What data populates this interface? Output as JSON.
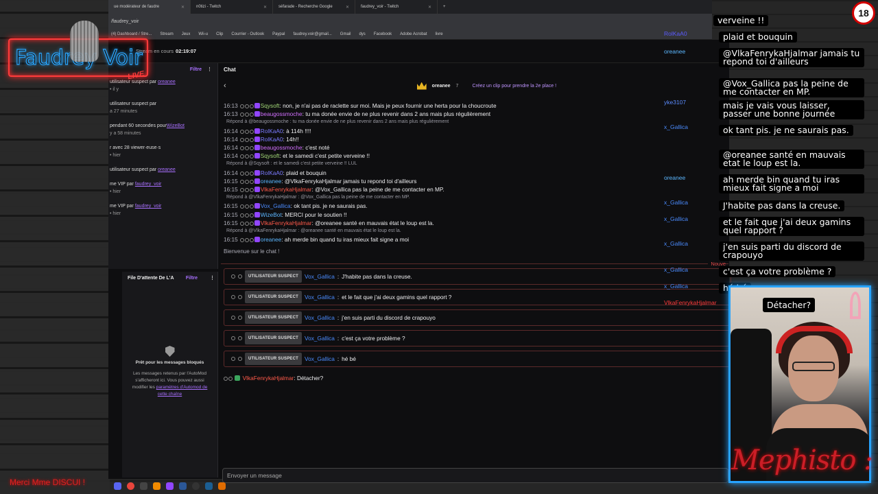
{
  "browser": {
    "tabs": [
      {
        "label": "ue modérateur de faudre"
      },
      {
        "label": "n0tizi - Twitch"
      },
      {
        "label": "séfarade - Recherche Google"
      },
      {
        "label": "faudrey_voir - Twitch"
      }
    ],
    "address": "/faudrey_voir",
    "bookmarks": [
      "(4) Dashboard / Stre...",
      "Stream",
      "Jeux",
      "Wii-u",
      "Clip",
      "Courrier - Outlook",
      "Paypal",
      "faudrey.voir@gmail...",
      "Gmail",
      "dys",
      "Facebook",
      "Adobe Acrobat",
      "livre"
    ]
  },
  "dashboard": {
    "stream_label": "Stream en cours",
    "stream_time": "02:19:07",
    "activity": {
      "filter": "Filtre",
      "items": [
        {
          "text": "utilisateur suspect par ",
          "link": "oreanee",
          "sub": "• il y"
        },
        {
          "text": "utilisateur suspect par",
          "link": "",
          "sub": "a 27 minutes"
        },
        {
          "text": "pendant 60 secondes pour",
          "link": "WizeBot",
          "sub": "y a 58 minutes"
        },
        {
          "text": "r avec 28 viewer·euse·s",
          "link": "",
          "sub": "• hier"
        },
        {
          "text": "utilisateur suspect par ",
          "link": "oreanee",
          "sub": ""
        },
        {
          "text": "me VIP par ",
          "link": "faudrey_voir",
          "sub": "• hier"
        },
        {
          "text": "me VIP par ",
          "link": "faudrey_voir",
          "sub": "• hier"
        }
      ]
    },
    "queue": {
      "title": "File D'attente De L'A",
      "filter": "Filtre",
      "empty_title": "Prêt pour les messages bloqués",
      "empty_text": "Les messages retenus par l'AutoMod s'afficheront ici. Vous pouvez aussi modifier les",
      "empty_link": "paramètres d'Automod de cette chaîne"
    }
  },
  "chat": {
    "title": "Chat",
    "pinned_user": "oreanee",
    "pinned_count": "7",
    "pinned_clip": "Créez un clip pour prendre la 2e place !",
    "messages": [
      {
        "time": "16:13",
        "user": "Sqysoft",
        "color": "#a3d977",
        "text": "non, je n'ai pas de raclette sur moi. Mais je peux fournir une herta pour la choucroute",
        "reply": ""
      },
      {
        "time": "16:13",
        "user": "beaugossmoche",
        "color": "#d270ff",
        "text": "tu ma donée envie de ne plus revenir dans 2 ans mais plus régulièrement",
        "reply": ""
      },
      {
        "time": "",
        "user": "",
        "color": "",
        "text": "",
        "reply": "Répond à @beaugossmoche : tu ma donée envie de ne plus revenir dans 2 ans mais plus régulièrement"
      },
      {
        "time": "16:14",
        "user": "RolKaA0",
        "color": "#7b7bff",
        "text": "à 114h !!!!",
        "reply": ""
      },
      {
        "time": "16:14",
        "user": "RolKaA0",
        "color": "#7b7bff",
        "text": "14h!!",
        "reply": ""
      },
      {
        "time": "16:14",
        "user": "beaugossmoche",
        "color": "#d270ff",
        "text": "c'est noté",
        "reply": ""
      },
      {
        "time": "16:14",
        "user": "Sqysoft",
        "color": "#a3d977",
        "text": "et le samedi c'est petite verveine !!",
        "reply": ""
      },
      {
        "time": "",
        "user": "",
        "color": "",
        "text": "",
        "reply": "Répond à @Sqysoft : et le samedi c'est petite verveine !! LUL"
      },
      {
        "time": "16:14",
        "user": "RolKaA0",
        "color": "#7b7bff",
        "text": "plaid et bouquin",
        "reply": ""
      },
      {
        "time": "16:15",
        "user": "oreanee",
        "color": "#5cb7ff",
        "text": "@VlkaFenrykaHjalmar jamais tu repond toi d'ailleurs",
        "reply": ""
      },
      {
        "time": "16:15",
        "user": "VlkaFenrykaHjalmar",
        "color": "#ff5a4a",
        "text": "@Vox_Gallica pas la peine de me contacter en MP.",
        "reply": ""
      },
      {
        "time": "",
        "user": "",
        "color": "",
        "text": "",
        "reply": "Répond à @VlkaFenrykaHjalmar : @Vox_Gallica pas la peine de me contacter en MP."
      },
      {
        "time": "16:15",
        "user": "Vox_Gallica",
        "color": "#4b8cff",
        "text": "ok tant pis. je ne saurais pas.",
        "reply": ""
      },
      {
        "time": "16:15",
        "user": "WizeBot",
        "color": "#5cb7ff",
        "text": "MERCI pour le soutien !!",
        "reply": ""
      },
      {
        "time": "16:15",
        "user": "VlkaFenrykaHjalmar",
        "color": "#ff5a4a",
        "text": "@oreanee santé en mauvais état le loup est la.",
        "reply": ""
      },
      {
        "time": "",
        "user": "",
        "color": "",
        "text": "",
        "reply": "Répond à @VlkaFenrykaHjalmar : @oreanee santé en mauvais état le loup est la."
      },
      {
        "time": "16:15",
        "user": "oreanee",
        "color": "#5cb7ff",
        "text": "ah merde bin quand tu iras mieux fait signe a moi",
        "reply": ""
      }
    ],
    "welcome": "Bienvenue sur le chat !",
    "new_label": "Nouve",
    "suspect_tag": "UTILISATEUR SUSPECT",
    "suspect_messages": [
      {
        "user": "Vox_Gallica",
        "text": "J'habite pas dans la creuse."
      },
      {
        "user": "Vox_Gallica",
        "text": "et le fait que j'ai deux gamins quel rapport ?"
      },
      {
        "user": "Vox_Gallica",
        "text": "j'en suis parti du discord de crapouyo"
      },
      {
        "user": "Vox_Gallica",
        "text": "c'est ça votre problème ?"
      },
      {
        "user": "Vox_Gallica",
        "text": "hé bé"
      }
    ],
    "last_message": {
      "user": "VlkaFenrykaHjalmar",
      "text": "Détacher?"
    },
    "input_placeholder": "Envoyer un message"
  },
  "side_names": [
    {
      "name": "RolKaA0",
      "color": "#5b5bff"
    },
    {
      "name": "oreanee",
      "color": "#5cb7ff"
    },
    {
      "name": "yke3107",
      "color": "#5b8cff"
    },
    {
      "name": "x_Gallica",
      "color": "#4b8cff"
    },
    {
      "name": "oreanee",
      "color": "#5cb7ff"
    },
    {
      "name": "x_Gallica",
      "color": "#4b8cff"
    },
    {
      "name": "x_Gallica",
      "color": "#4b8cff"
    },
    {
      "name": "x_Gallica",
      "color": "#4b8cff"
    },
    {
      "name": "x_Gallica",
      "color": "#4b8cff"
    },
    {
      "name": "x_Gallica",
      "color": "#4b8cff"
    },
    {
      "name": "VlkaFenrykaHjalmar",
      "color": "#ff3b3b"
    }
  ],
  "overlay_chat": [
    "verveine !!",
    "plaid et bouquin",
    "@VlkaFenrykaHjalmar jamais tu repond toi d'ailleurs",
    "@Vox_Gallica pas la peine de me contacter en MP.",
    "mais je vais vous laisser, passer une bonne journée",
    "ok tant pis. je ne saurais pas.",
    "@oreanee santé en mauvais etat le loup est la.",
    "ah merde bin quand tu iras mieux fait signe a moi",
    "J'habite pas dans la creuse.",
    "et le fait que j'ai deux gamins quel rapport ?",
    "j'en suis parti du discord de crapouyo",
    "c'est ça votre problème ?",
    "hé bé"
  ],
  "overlay_detach": "Détacher?",
  "logo_text": "Faudrey Voir",
  "logo_live": "LIVE",
  "age_badge": "18",
  "cam_caption": "Mephisto : Dr",
  "ticker": "Merci Mme DISCUI !"
}
